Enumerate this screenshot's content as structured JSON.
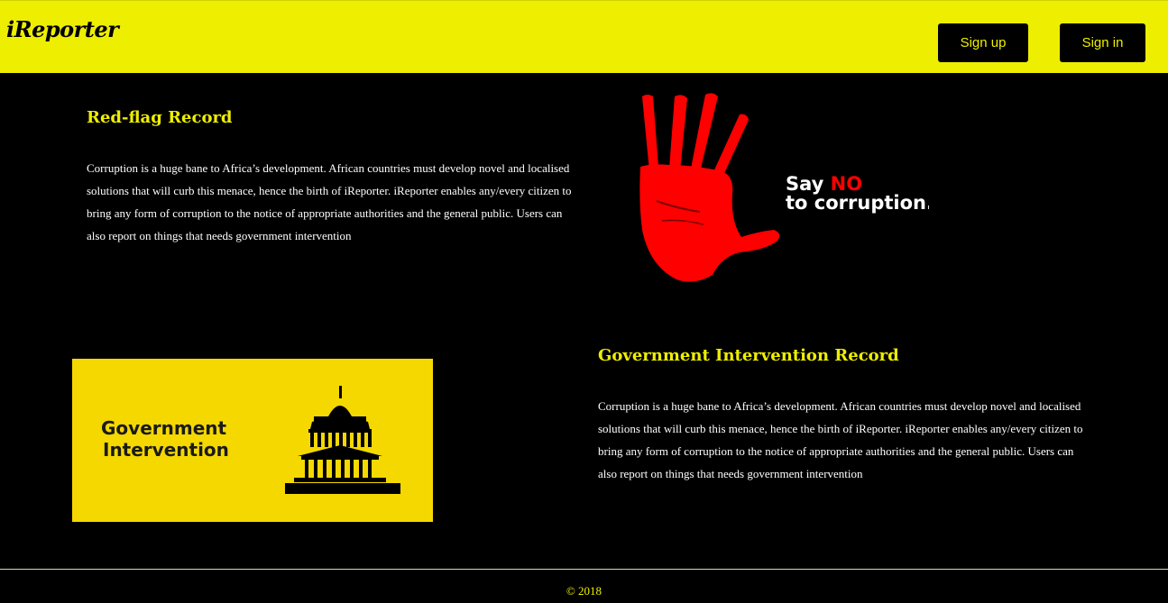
{
  "header": {
    "logo": "iReporter",
    "signup_label": "Sign up",
    "signin_label": "Sign in"
  },
  "redflag": {
    "title": "Red-flag Record",
    "body": "Corruption is a huge bane to Africa’s development. African countries must develop novel and localised solutions that will curb this menace, hence the birth of iReporter. iReporter enables any/every citizen to bring any form of corruption to the notice of appropriate authorities and the general public. Users can also report on things that needs government intervention",
    "image": {
      "line1_a": "Say ",
      "line1_b": "NO",
      "line2": "to corruption."
    }
  },
  "intervention": {
    "title": "Government Intervention Record",
    "body": "Corruption is a huge bane to Africa’s development. African countries must develop novel and localised solutions that will curb this menace, hence the birth of iReporter. iReporter enables any/every citizen to bring any form of corruption to the notice of appropriate authorities and the general public. Users can also report on things that needs government intervention",
    "image": {
      "line1": "Government",
      "line2": "Intervention"
    }
  },
  "footer": {
    "copyright": "© 2018"
  },
  "colors": {
    "accent": "#eeee00",
    "background": "#000000",
    "hand": "#ff0000"
  }
}
